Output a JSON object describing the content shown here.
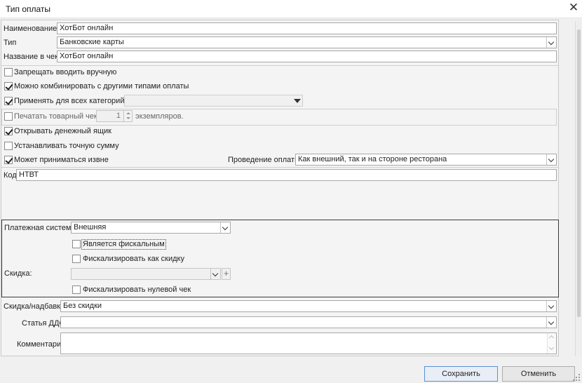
{
  "window": {
    "title": "Тип оплаты",
    "close_glyph": "✕"
  },
  "fields": {
    "name": {
      "label": "Наименование",
      "value": "ХотБот онлайн"
    },
    "type": {
      "label": "Тип",
      "value": "Банковские карты"
    },
    "receipt_name": {
      "label": "Название в чеке",
      "value": "ХотБот онлайн"
    }
  },
  "options": {
    "forbid_manual": {
      "label": "Запрещать вводить вручную",
      "checked": false
    },
    "combine": {
      "label": "Можно комбинировать с другими типами оплаты",
      "checked": true
    },
    "all_categories": {
      "label": "Применять для всех категорий блюд",
      "checked": true,
      "value": ""
    },
    "print_receipt": {
      "label": "Печатать товарный чек,",
      "checked": false,
      "copies": "1",
      "suffix": "экземпляров."
    },
    "open_drawer": {
      "label": "Открывать денежный ящик",
      "checked": true
    },
    "exact_sum": {
      "label": "Устанавливать точную сумму",
      "checked": false
    },
    "external": {
      "label": "Может приниматься извне",
      "checked": true
    }
  },
  "processing": {
    "label": "Проведение оплаты:",
    "value": "Как внешний, так и на стороне ресторана"
  },
  "code": {
    "label": "Код",
    "value": "НТВТ"
  },
  "payment_system": {
    "label": "Платежная система:",
    "value": "Внешняя",
    "is_fiscal": {
      "label": "Является фискальным",
      "checked": false
    },
    "fiscalize_discount": {
      "label": "Фискализировать как скидку",
      "checked": false
    },
    "discount_label": "Скидка:",
    "discount_value": "",
    "zero_receipt": {
      "label": "Фискализировать нулевой чек",
      "checked": false
    }
  },
  "bottom": {
    "discount_markup": {
      "label": "Скидка/надбавка",
      "value": "Без скидки"
    },
    "dds_article": {
      "label": "Статья ДДС",
      "value": ""
    },
    "comment": {
      "label": "Комментарий",
      "value": ""
    }
  },
  "buttons": {
    "save": "Сохранить",
    "cancel": "Отменить"
  },
  "icons": {
    "close": "close-icon",
    "dropdown": "chevron-down-icon",
    "add": "plus-icon",
    "check": "checkmark-icon"
  },
  "colors": {
    "primary_button_border": "#5b8fd3",
    "group_border": "#3a3a3a"
  }
}
